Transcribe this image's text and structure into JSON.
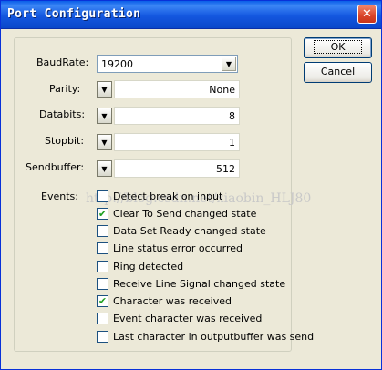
{
  "window": {
    "title": "Port Configuration",
    "close_glyph": "✕"
  },
  "buttons": {
    "ok": "OK",
    "cancel": "Cancel"
  },
  "fields": {
    "baudrate": {
      "label": "BaudRate:",
      "value": "19200"
    },
    "parity": {
      "label": "Parity:",
      "value": "None"
    },
    "databits": {
      "label": "Databits:",
      "value": "8"
    },
    "stopbit": {
      "label": "Stopbit:",
      "value": "1"
    },
    "sendbuffer": {
      "label": "Sendbuffer:",
      "value": "512"
    }
  },
  "events": {
    "label": "Events:",
    "items": [
      {
        "label": "Detect break on input",
        "checked": false
      },
      {
        "label": "Clear To Send changed state",
        "checked": true
      },
      {
        "label": "Data Set Ready changed state",
        "checked": false
      },
      {
        "label": "Line status error occurred",
        "checked": false
      },
      {
        "label": "Ring detected",
        "checked": false
      },
      {
        "label": "Receive Line Signal changed state",
        "checked": false
      },
      {
        "label": "Character was received",
        "checked": true
      },
      {
        "label": "Event character was received",
        "checked": false
      },
      {
        "label": "Last character in outputbuffer was send",
        "checked": false
      }
    ]
  },
  "watermark": "http://blog.csdn.net/xiaobin_HLJ80",
  "colors": {
    "titlebar": "#0a5ee8",
    "face": "#ece9d8",
    "check": "#21a121"
  }
}
